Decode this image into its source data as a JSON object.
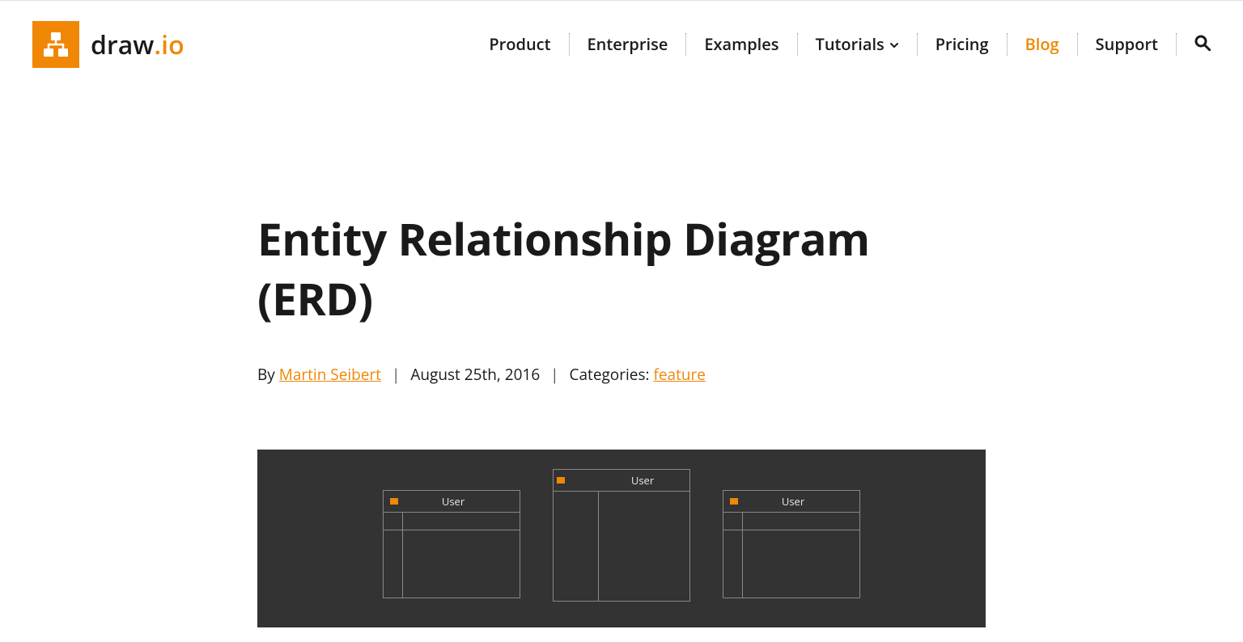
{
  "brand": {
    "name_prefix": "draw",
    "name_suffix": ".io"
  },
  "nav": {
    "items": [
      {
        "label": "Product",
        "active": false,
        "has_chevron": false
      },
      {
        "label": "Enterprise",
        "active": false,
        "has_chevron": false
      },
      {
        "label": "Examples",
        "active": false,
        "has_chevron": false
      },
      {
        "label": "Tutorials",
        "active": false,
        "has_chevron": true
      },
      {
        "label": "Pricing",
        "active": false,
        "has_chevron": false
      },
      {
        "label": "Blog",
        "active": true,
        "has_chevron": false
      },
      {
        "label": "Support",
        "active": false,
        "has_chevron": false
      }
    ]
  },
  "article": {
    "title": "Entity Relationship Diagram (ERD)",
    "by_label": "By ",
    "author": "Martin Seibert",
    "date": "August 25th, 2016",
    "categories_label": "Categories: ",
    "category": "feature"
  },
  "diagram": {
    "entity_label": "User"
  }
}
